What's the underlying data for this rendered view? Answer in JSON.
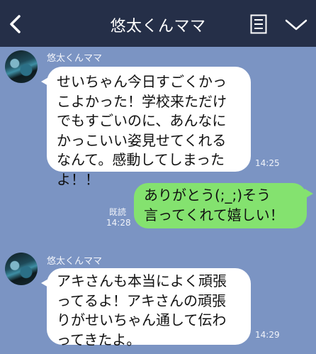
{
  "header": {
    "title": "悠太くんママ",
    "back_icon": "chevron-left-icon",
    "menu_icon": "notes-icon",
    "expand_icon": "chevron-down-icon"
  },
  "messages": [
    {
      "sender": "悠太くんママ",
      "lines": [
        "せいちゃん今日すごくかっ",
        "こよかった！学校来ただけ",
        "でもすごいのに、あんなに",
        "かっこいい姿見せてくれる",
        "なんて。感動してしまった",
        "よ！！"
      ],
      "time": "14:25"
    },
    {
      "lines": [
        "ありがとう(;_;)そう",
        "言ってくれて嬉しい！"
      ],
      "read": "既読",
      "time": "14:28"
    },
    {
      "sender": "悠太くんママ",
      "lines": [
        "アキさんも本当によく頑張",
        "ってるよ！アキさんの頑張",
        "りがせいちゃん通して伝わ",
        "ってきたよ。"
      ],
      "time": "14:29"
    }
  ],
  "colors": {
    "header_bg": "#252f48",
    "chat_bg": "#7b94c3",
    "incoming_bubble": "#ffffff",
    "outgoing_bubble": "#84e26f"
  }
}
